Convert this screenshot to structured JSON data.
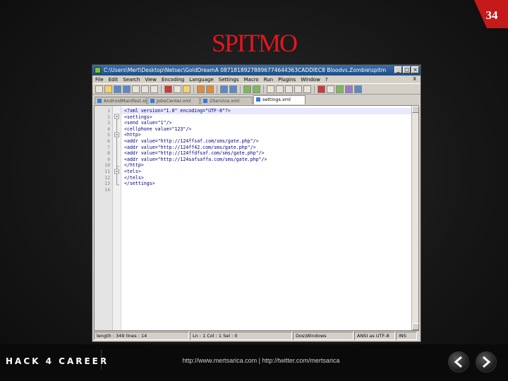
{
  "slide": {
    "number": "34",
    "title": "SPITMO"
  },
  "window": {
    "title": "C:\\Users\\Mert\\Desktop\\Netsec\\GoldDreamA  08718189278896774644363CADDIEC8  Bloodvs.Zombie\\spitmo",
    "menu": [
      "File",
      "Edit",
      "Search",
      "View",
      "Encoding",
      "Language",
      "Settings",
      "Macro",
      "Run",
      "Plugins",
      "Window",
      "?"
    ],
    "menu_close": "X",
    "tabs": [
      "AndroidManifest.xml",
      "JobsCenter.xml",
      "2Service.xml",
      "settings.xml"
    ],
    "active_tab": 3,
    "line_numbers": [
      "1",
      "2",
      "3",
      "4",
      "5",
      "6",
      "7",
      "8",
      "9",
      "10",
      "11",
      "12",
      "13",
      "14"
    ],
    "code": [
      "<?xml version=\"1.0\" encoding=\"UTF-8\"?>",
      "<settings>",
      "<send value=\"1\"/>",
      "<cellphone value=\"123\"/>",
      "<http>",
      "<addr value=\"http://124ffsaf.com/sms/gate.php\"/>",
      "<addr value=\"http://124ff42.com/sms/gate.php\"/>",
      "<addr value=\"http://124ffdfsaf.com/sms/gate.php\"/>",
      "<addr value=\"http://124safsaffa.com/sms/gate.php\"/>",
      "</http>",
      "<tels>",
      "</tels>",
      "</settings>",
      ""
    ],
    "status": [
      "length : 349    lines : 14",
      "Ln : 1    Col : 1    Sel : 0",
      "Dos\\Windows",
      "ANSI as UTF-8",
      "INS"
    ]
  },
  "footer": {
    "logo": "HACK 4 CAREER",
    "links": "http://www.mertsarica.com | http://twitter.com/mertsarica"
  },
  "colors": {
    "title": "#e8141e",
    "corner": "#c41a1a"
  }
}
